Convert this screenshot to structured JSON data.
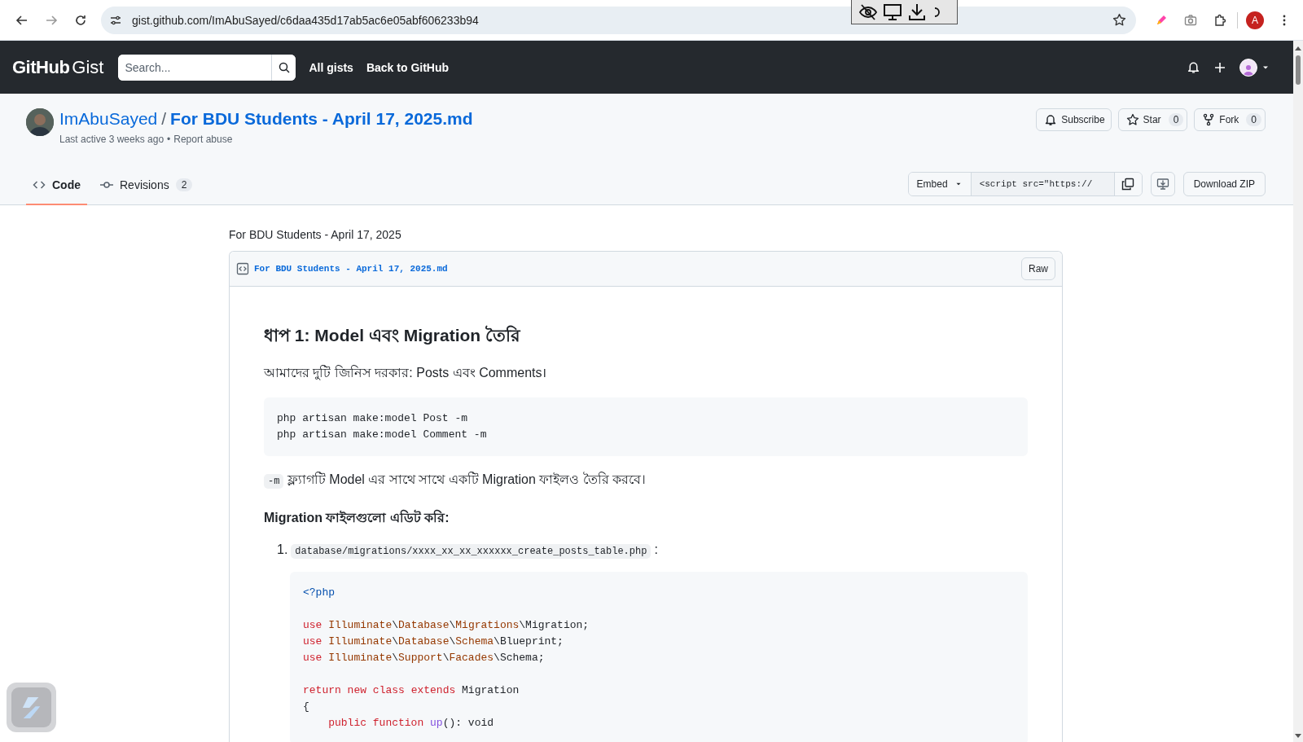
{
  "browser": {
    "url": "gist.github.com/ImAbuSayed/c6daa435d17ab5ac6e05abf606233b94",
    "profile_initial": "A"
  },
  "header": {
    "logo_main": "GitHub",
    "logo_sub": "Gist",
    "search": {
      "placeholder": "Search..."
    },
    "nav": [
      "All gists",
      "Back to GitHub"
    ]
  },
  "gist": {
    "owner": "ImAbuSayed",
    "separator": "/",
    "title": "For BDU Students - April 17, 2025.md",
    "last_active": "Last active 3 weeks ago",
    "bullet": "•",
    "report": "Report abuse",
    "actions": [
      {
        "kind": "subscribe",
        "label": "Subscribe"
      },
      {
        "kind": "star",
        "label": "Star",
        "count": "0"
      },
      {
        "kind": "fork",
        "label": "Fork",
        "count": "0"
      }
    ],
    "tabs": [
      {
        "kind": "code",
        "label": "Code",
        "selected": true
      },
      {
        "kind": "revisions",
        "label": "Revisions",
        "count": "2",
        "selected": false
      }
    ],
    "embed": {
      "label": "Embed",
      "value": "<script src=\"https://"
    },
    "download": "Download ZIP"
  },
  "description": "For BDU Students - April 17, 2025",
  "file": {
    "name": "For BDU Students - April 17, 2025.md",
    "raw": "Raw",
    "body": [
      {
        "kind": "h2",
        "text": "ধাপ 1: Model এবং Migration তৈরি"
      },
      {
        "kind": "p",
        "text": "আমাদের দুটি জিনিস দরকার: Posts এবং Comments।"
      },
      {
        "kind": "code",
        "lines": [
          {
            "tokens": [
              {
                "text": "php artisan make:model Post -m",
                "kind": "plain"
              }
            ]
          },
          {
            "tokens": [
              {
                "text": "php artisan make:model Comment -m",
                "kind": "plain"
              }
            ]
          }
        ]
      },
      {
        "kind": "p_code",
        "code": "-m",
        "text": "ফ্ল্যাগটি Model এর সাথে সাথে একটি Migration ফাইলও তৈরি করবে।"
      },
      {
        "kind": "h3",
        "text": "Migration ফাইলগুলো এডিট করি:"
      },
      {
        "kind": "ol",
        "items": [
          {
            "number": "1.",
            "code": "database/migrations/xxxx_xx_xx_xxxxxx_create_posts_table.php",
            "suffix": ":",
            "block": [
              {
                "tokens": [
                  {
                    "text": "<?php",
                    "kind": "tag"
                  }
                ]
              },
              {
                "gap_before": true,
                "tokens": [
                  {
                    "text": "use",
                    "kind": "keyword"
                  },
                  {
                    "text": " Illuminate",
                    "kind": "ns"
                  },
                  {
                    "text": "\\",
                    "kind": "plain"
                  },
                  {
                    "text": "Database",
                    "kind": "ns"
                  },
                  {
                    "text": "\\",
                    "kind": "plain"
                  },
                  {
                    "text": "Migrations",
                    "kind": "ns"
                  },
                  {
                    "text": "\\Migration;",
                    "kind": "plain"
                  }
                ]
              },
              {
                "tokens": [
                  {
                    "text": "use",
                    "kind": "keyword"
                  },
                  {
                    "text": " Illuminate",
                    "kind": "ns"
                  },
                  {
                    "text": "\\",
                    "kind": "plain"
                  },
                  {
                    "text": "Database",
                    "kind": "ns"
                  },
                  {
                    "text": "\\",
                    "kind": "plain"
                  },
                  {
                    "text": "Schema",
                    "kind": "ns"
                  },
                  {
                    "text": "\\Blueprint;",
                    "kind": "plain"
                  }
                ]
              },
              {
                "tokens": [
                  {
                    "text": "use",
                    "kind": "keyword"
                  },
                  {
                    "text": " Illuminate",
                    "kind": "ns"
                  },
                  {
                    "text": "\\",
                    "kind": "plain"
                  },
                  {
                    "text": "Support",
                    "kind": "ns"
                  },
                  {
                    "text": "\\",
                    "kind": "plain"
                  },
                  {
                    "text": "Facades",
                    "kind": "ns"
                  },
                  {
                    "text": "\\Schema;",
                    "kind": "plain"
                  }
                ]
              },
              {
                "gap_before": true,
                "tokens": [
                  {
                    "text": "return",
                    "kind": "keyword"
                  },
                  {
                    "text": " new",
                    "kind": "keyword"
                  },
                  {
                    "text": " class",
                    "kind": "keyword"
                  },
                  {
                    "text": " extends",
                    "kind": "keyword"
                  },
                  {
                    "text": " Migration",
                    "kind": "plain"
                  }
                ]
              },
              {
                "tokens": [
                  {
                    "text": "{",
                    "kind": "plain"
                  }
                ]
              },
              {
                "tokens": [
                  {
                    "text": "    public",
                    "kind": "keyword"
                  },
                  {
                    "text": " function",
                    "kind": "keyword"
                  },
                  {
                    "text": " up",
                    "kind": "func"
                  },
                  {
                    "text": "(): void",
                    "kind": "plain"
                  }
                ]
              }
            ]
          }
        ]
      }
    ]
  }
}
